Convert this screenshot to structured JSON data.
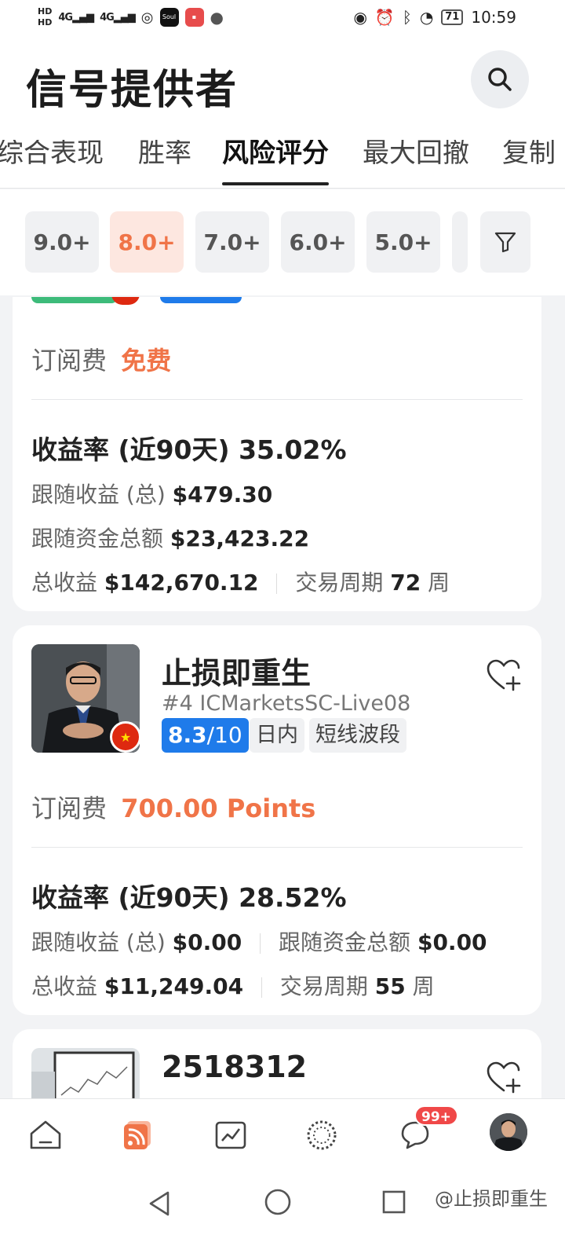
{
  "status_bar": {
    "time": "10:59",
    "battery": "71",
    "hd1": "HD",
    "hd2": "HD",
    "signal1": "4G",
    "signal2": "4G"
  },
  "header": {
    "title": "信号提供者",
    "search_icon": "search-icon"
  },
  "tabs": [
    {
      "label": "综合表现"
    },
    {
      "label": "胜率"
    },
    {
      "label": "风险评分",
      "active": true
    },
    {
      "label": "最大回撤"
    },
    {
      "label": "复制"
    }
  ],
  "filters": {
    "chips": [
      "9.0+",
      "8.0+",
      "7.0+",
      "6.0+",
      "5.0+"
    ],
    "active": "8.0+",
    "filter_icon": "funnel-icon"
  },
  "card1": {
    "fee_label": "订阅费",
    "fee_value": "免费",
    "return_label": "收益率 (近90天)",
    "return_value": "35.02%",
    "follow_profit_label": "跟随收益 (总)",
    "follow_profit_value": "$479.30",
    "follow_fund_label": "跟随资金总额",
    "follow_fund_value": "$23,423.22",
    "total_profit_label": "总收益",
    "total_profit_value": "$142,670.12",
    "period_label": "交易周期",
    "period_value": "72",
    "period_unit": "周"
  },
  "card2": {
    "name": "止损即重生",
    "account": "#4 ICMarketsSC-Live08",
    "score": "8.3",
    "score_max": "/10",
    "tags": [
      "日内",
      "短线波段"
    ],
    "fee_label": "订阅费",
    "fee_value": "700.00 Points",
    "return_label": "收益率 (近90天)",
    "return_value": "28.52%",
    "follow_profit_label": "跟随收益 (总)",
    "follow_profit_value": "$0.00",
    "follow_fund_label": "跟随资金总额",
    "follow_fund_value": "$0.00",
    "total_profit_label": "总收益",
    "total_profit_value": "$11,249.04",
    "period_label": "交易周期",
    "period_value": "55",
    "period_unit": "周"
  },
  "card3": {
    "name": "2518312"
  },
  "bottom_nav": {
    "items": [
      "home-icon",
      "signals-icon",
      "chart-icon",
      "community-icon",
      "chat-icon",
      "profile-avatar"
    ],
    "chat_badge": "99+",
    "active": "signals-icon"
  },
  "system_nav": {
    "watermark": "@止损即重生"
  },
  "colors": {
    "accent": "#f07448",
    "score_blue": "#1f7bea",
    "active_chip_bg": "#fde7e0"
  }
}
